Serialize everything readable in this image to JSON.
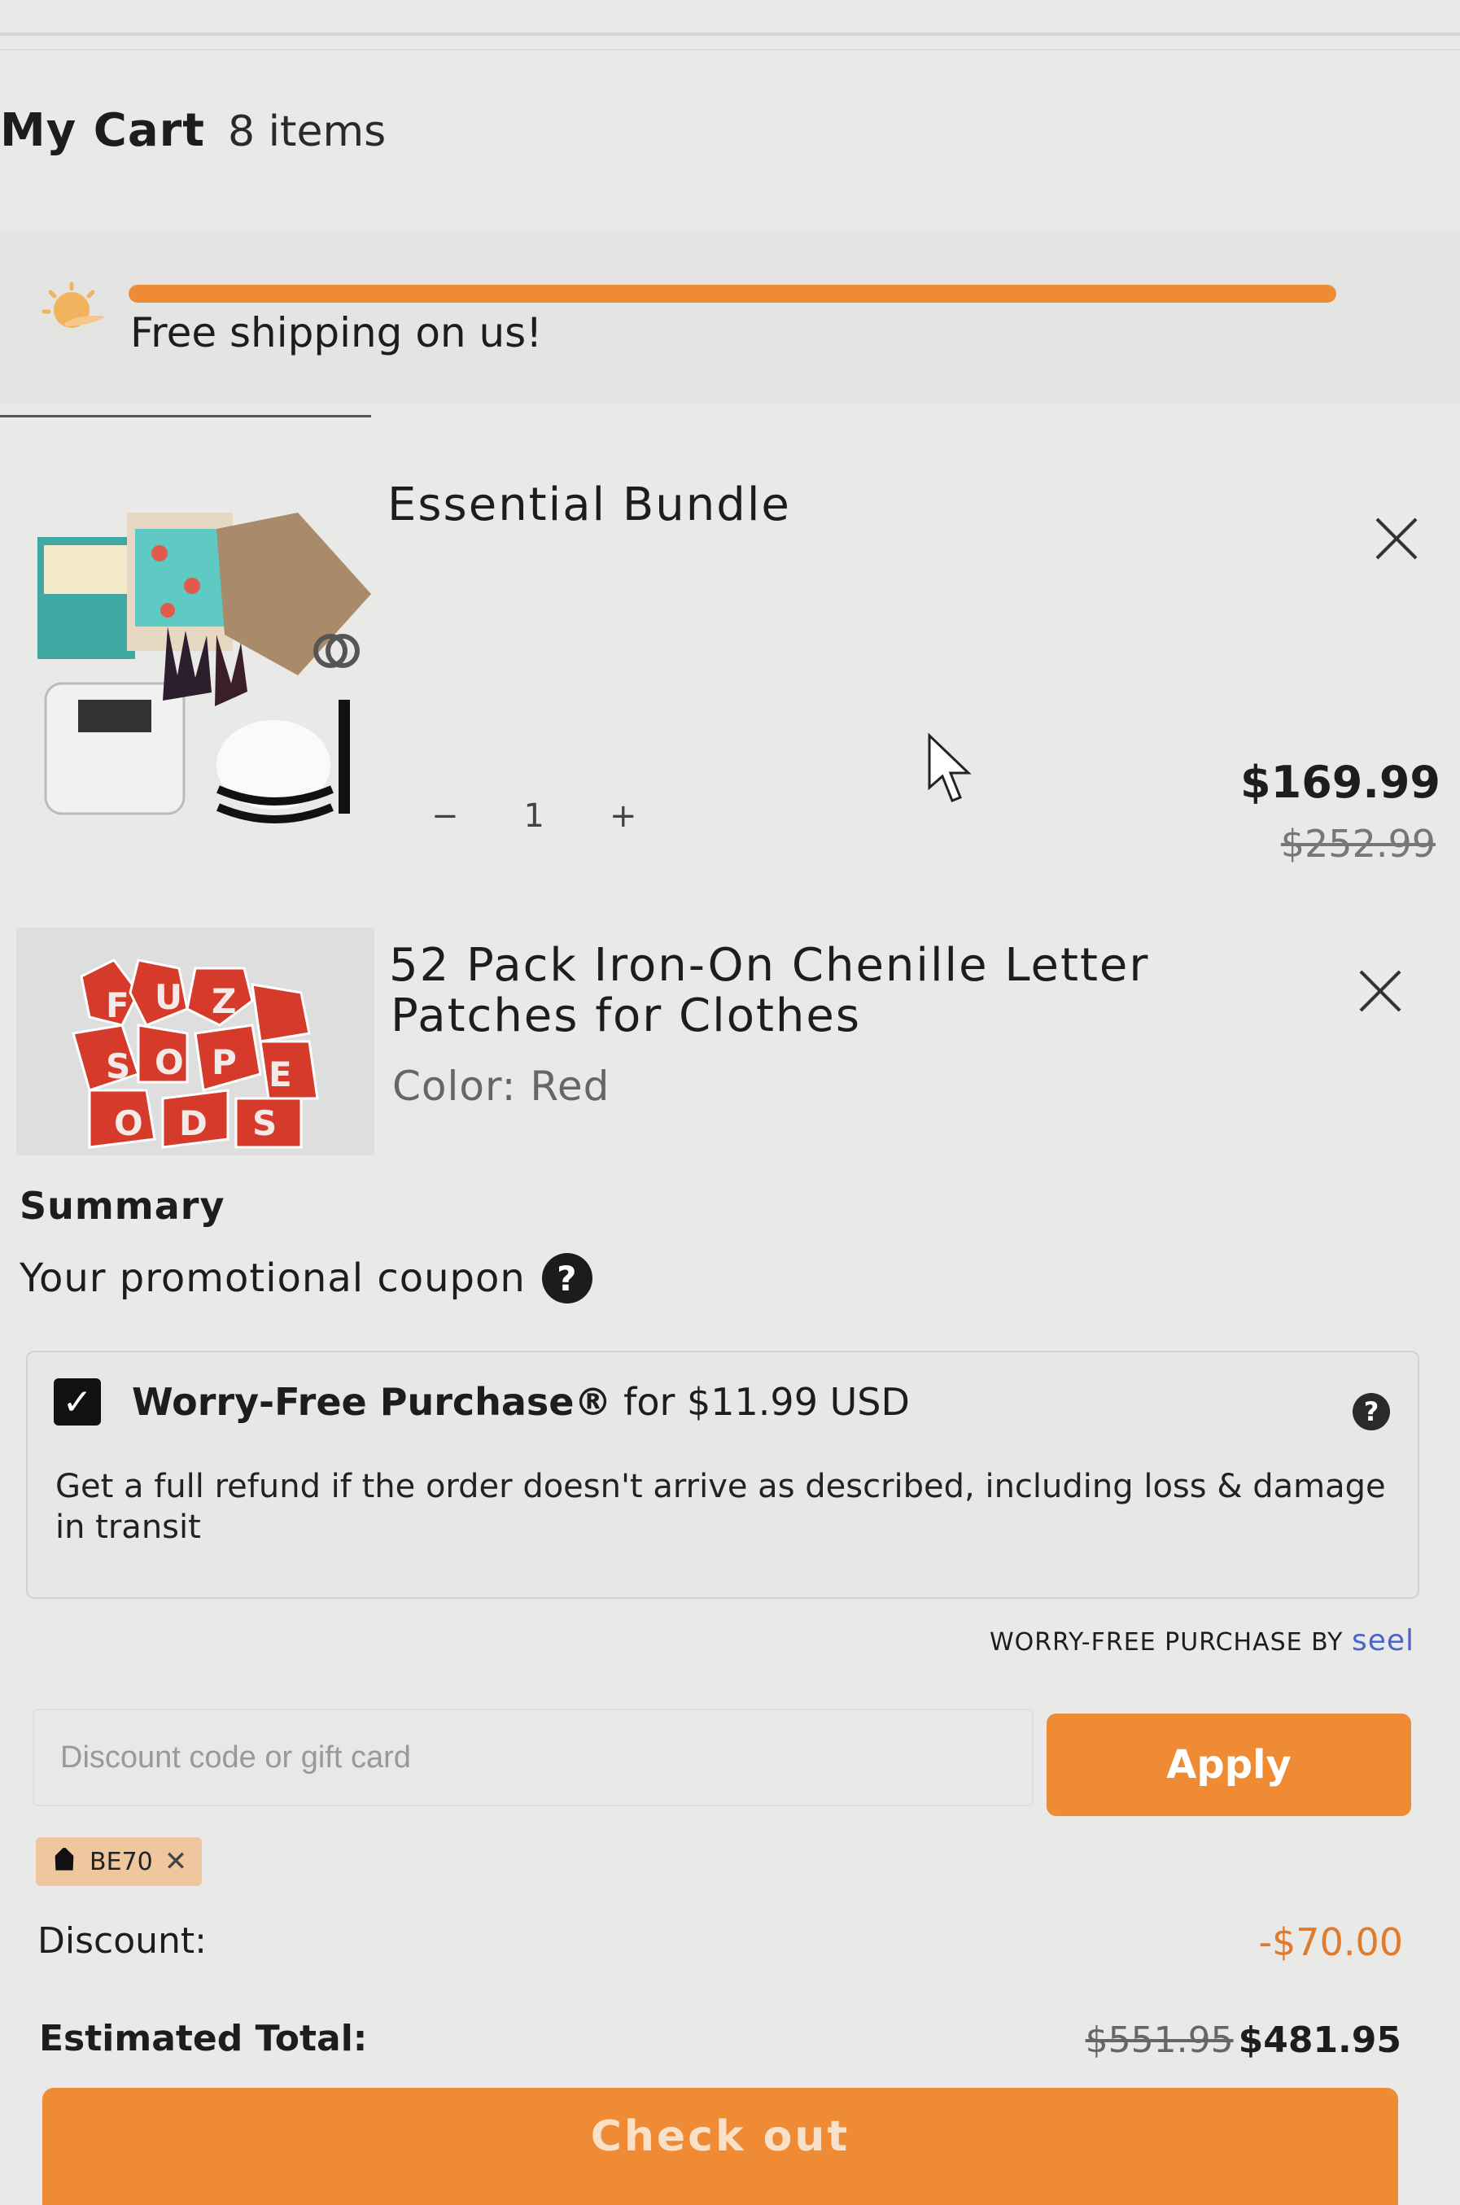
{
  "header": {
    "title": "My Cart",
    "count": "8 items"
  },
  "shipping": {
    "message": "Free shipping on us!",
    "progress": 1.0,
    "icon": "sun-icon"
  },
  "items": [
    {
      "title": "Essential Bundle",
      "quantity": "1",
      "minus_label": "−",
      "plus_label": "+",
      "price": "$169.99",
      "original_price": "$252.99"
    },
    {
      "title_line1": "52 Pack Iron-On Chenille Letter",
      "title_line2": "Patches for Clothes",
      "variant": "Color: Red"
    }
  ],
  "summary": {
    "title": "Summary",
    "promo_label": "Your promotional coupon",
    "help_glyph": "?"
  },
  "worry_free": {
    "checked": true,
    "check_glyph": "✓",
    "title_bold": "Worry-Free Purchase®",
    "title_rest": " for $11.99 USD",
    "description": "Get a full refund if the order doesn't arrive as described, including loss & damage in transit",
    "attribution": "WORRY-FREE PURCHASE BY ",
    "brand": "seel"
  },
  "discount": {
    "placeholder": "Discount code or gift card",
    "apply_label": "Apply",
    "applied_code": "BE70",
    "remove_glyph": "✕",
    "label": "Discount:",
    "value": "-$70.00"
  },
  "total": {
    "label": "Estimated Total:",
    "original": "$551.95",
    "current": "$481.95"
  },
  "checkout": {
    "label": "Check out"
  },
  "colors": {
    "accent": "#ef8a35",
    "discount": "#e07a2c",
    "seel": "#4a64c8"
  }
}
